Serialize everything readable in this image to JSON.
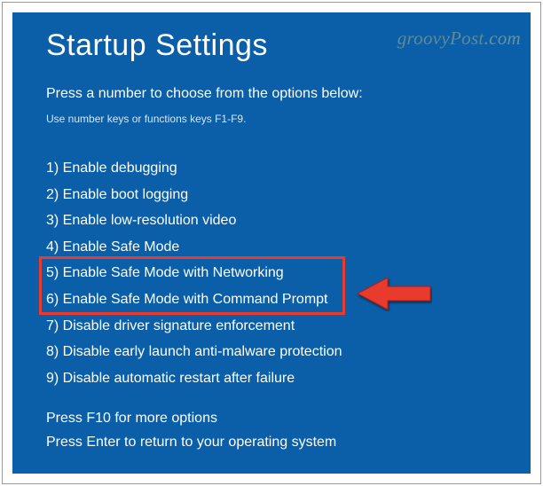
{
  "title": "Startup Settings",
  "subtitle": "Press a number to choose from the options below:",
  "hint": "Use number keys or functions keys F1-F9.",
  "options": [
    "1) Enable debugging",
    "2) Enable boot logging",
    "3) Enable low-resolution video",
    "4) Enable Safe Mode",
    "5) Enable Safe Mode with Networking",
    "6) Enable Safe Mode with Command Prompt",
    "7) Disable driver signature enforcement",
    "8) Disable early launch anti-malware protection",
    "9) Disable automatic restart after failure"
  ],
  "footer": {
    "line1": "Press F10 for more options",
    "line2": "Press Enter to return to your operating system"
  },
  "watermark": "groovyPost",
  "watermark_suffix": ".com",
  "highlight_index": 6,
  "colors": {
    "background": "#0a5fa8",
    "highlight": "#e83a2f"
  }
}
